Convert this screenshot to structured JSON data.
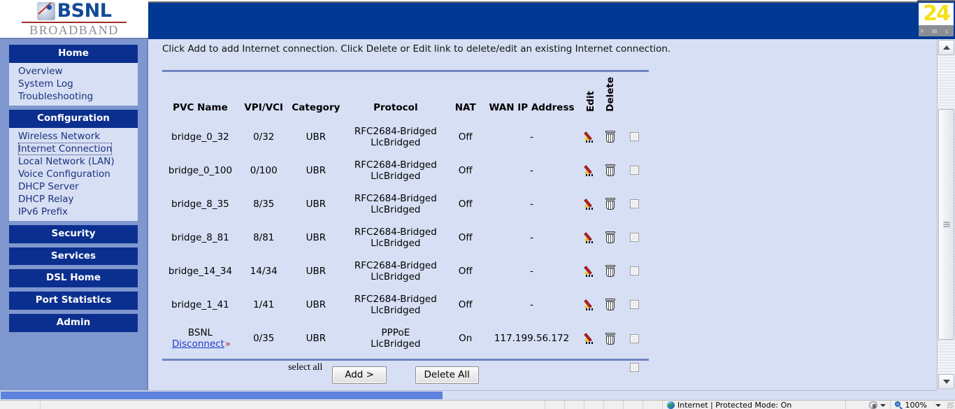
{
  "brand": {
    "name": "BSNL",
    "subtitle": "BROADBAND",
    "logo_icon": "bsnl-satellite-icon"
  },
  "corner_logo": {
    "number": "24",
    "letters": "v m c"
  },
  "sidebar": {
    "groups": [
      {
        "header": "Home",
        "items": [
          {
            "label": "Overview",
            "focused": false
          },
          {
            "label": "System Log",
            "focused": false
          },
          {
            "label": "Troubleshooting",
            "focused": false
          }
        ]
      },
      {
        "header": "Configuration",
        "items": [
          {
            "label": "Wireless Network",
            "focused": false
          },
          {
            "label": "Internet Connection",
            "focused": true
          },
          {
            "label": "Local Network (LAN)",
            "focused": false
          },
          {
            "label": "Voice Configuration",
            "focused": false
          },
          {
            "label": "DHCP Server",
            "focused": false
          },
          {
            "label": "DHCP Relay",
            "focused": false
          },
          {
            "label": "IPv6 Prefix",
            "focused": false
          }
        ]
      },
      {
        "header": "Security",
        "items": []
      },
      {
        "header": "Services",
        "items": []
      },
      {
        "header": "DSL Home",
        "items": []
      },
      {
        "header": "Port Statistics",
        "items": []
      },
      {
        "header": "Admin",
        "items": []
      }
    ]
  },
  "main": {
    "intro": "Click Add to add Internet connection. Click Delete or Edit link to delete/edit an existing Internet connection.",
    "table": {
      "headers": {
        "pvc_name": "PVC Name",
        "vpi_vci": "VPI/VCI",
        "category": "Category",
        "protocol": "Protocol",
        "nat": "NAT",
        "wan_ip": "WAN IP Address",
        "edit": "Edit",
        "delete": "Delete"
      },
      "rows": [
        {
          "pvc_name": "bridge_0_32",
          "sub_link": "",
          "vpi_vci": "0/32",
          "category": "UBR",
          "protocol_line1": "RFC2684-Bridged",
          "protocol_line2": "LlcBridged",
          "nat": "Off",
          "wan_ip": "-"
        },
        {
          "pvc_name": "bridge_0_100",
          "sub_link": "",
          "vpi_vci": "0/100",
          "category": "UBR",
          "protocol_line1": "RFC2684-Bridged",
          "protocol_line2": "LlcBridged",
          "nat": "Off",
          "wan_ip": "-"
        },
        {
          "pvc_name": "bridge_8_35",
          "sub_link": "",
          "vpi_vci": "8/35",
          "category": "UBR",
          "protocol_line1": "RFC2684-Bridged",
          "protocol_line2": "LlcBridged",
          "nat": "Off",
          "wan_ip": "-"
        },
        {
          "pvc_name": "bridge_8_81",
          "sub_link": "",
          "vpi_vci": "8/81",
          "category": "UBR",
          "protocol_line1": "RFC2684-Bridged",
          "protocol_line2": "LlcBridged",
          "nat": "Off",
          "wan_ip": "-"
        },
        {
          "pvc_name": "bridge_14_34",
          "sub_link": "",
          "vpi_vci": "14/34",
          "category": "UBR",
          "protocol_line1": "RFC2684-Bridged",
          "protocol_line2": "LlcBridged",
          "nat": "Off",
          "wan_ip": "-"
        },
        {
          "pvc_name": "bridge_1_41",
          "sub_link": "",
          "vpi_vci": "1/41",
          "category": "UBR",
          "protocol_line1": "RFC2684-Bridged",
          "protocol_line2": "LlcBridged",
          "nat": "Off",
          "wan_ip": "-"
        },
        {
          "pvc_name": "BSNL",
          "sub_link": "Disconnect",
          "vpi_vci": "0/35",
          "category": "UBR",
          "protocol_line1": "PPPoE",
          "protocol_line2": "LlcBridged",
          "nat": "On",
          "wan_ip": "117.199.56.172"
        }
      ],
      "select_all_label": "select all"
    },
    "buttons": {
      "add": "Add >",
      "delete_all": "Delete All"
    }
  },
  "statusbar": {
    "zone_text": "Internet | Protected Mode: On",
    "zoom_level": "100%",
    "globe_icon": "internet-zone-globe-icon",
    "shield_icon": "protected-mode-shield-icon",
    "zoom_icon": "magnifier-zoom-icon"
  }
}
